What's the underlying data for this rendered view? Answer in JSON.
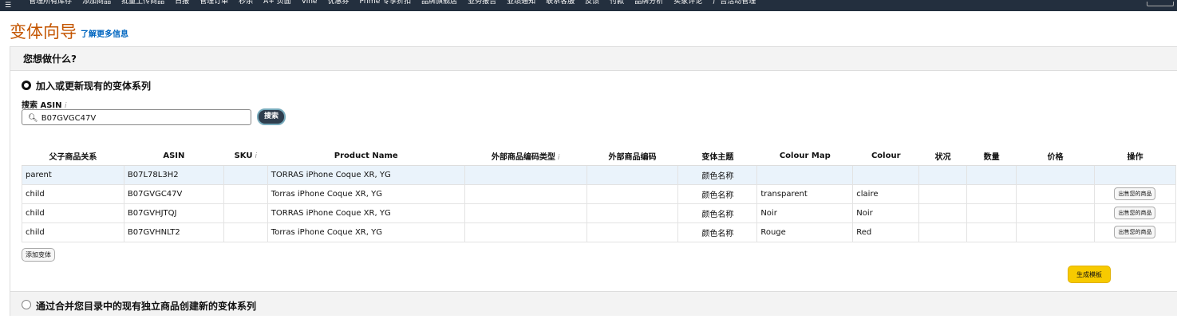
{
  "topnav": {
    "items": [
      "管理所有库存",
      "添加商品",
      "批量上传商品",
      "日报",
      "管理订单",
      "秒杀",
      "A+ 页面",
      "Vine",
      "优惠券",
      "Prime 专享折扣",
      "品牌旗舰店",
      "业务报告",
      "业绩通知",
      "联系客服",
      "反馈",
      "付款",
      "品牌分析",
      "买家评论",
      "广告活动管理"
    ]
  },
  "page": {
    "title": "变体向导",
    "learn_more": "了解更多信息"
  },
  "panel": {
    "header": "您想做什么?",
    "option1_label": "加入或更新现有的变体系列",
    "search_label": "搜索 ASIN",
    "search_value": "B07GVGC47V",
    "search_button": "搜索",
    "info_glyph": "i",
    "add_variation": "添加变体",
    "generate_template": "生成模板",
    "option2_label": "通过合并您目录中的现有独立商品创建新的变体系列"
  },
  "table": {
    "headers": [
      "父子商品关系",
      "ASIN",
      "SKU",
      "Product Name",
      "外部商品编码类型",
      "外部商品编码",
      "变体主题",
      "Colour Map",
      "Colour",
      "状况",
      "数量",
      "价格",
      "操作"
    ],
    "rows": [
      {
        "rel": "parent",
        "asin": "B07L78L3H2",
        "sku": "",
        "name": "TORRAS iPhone Coque XR, YG",
        "ext_type": "",
        "ext_code": "",
        "theme": "颜色名称",
        "colour_map": "",
        "colour": "",
        "condition": "",
        "qty": "",
        "price": "",
        "action": ""
      },
      {
        "rel": "child",
        "asin": "B07GVGC47V",
        "sku": "",
        "name": "Torras iPhone Coque XR, YG",
        "ext_type": "",
        "ext_code": "",
        "theme": "颜色名称",
        "colour_map": "transparent",
        "colour": "claire",
        "condition": "",
        "qty": "",
        "price": "",
        "action": "出售您的商品"
      },
      {
        "rel": "child",
        "asin": "B07GVHJTQJ",
        "sku": "",
        "name": "TORRAS iPhone Coque XR, YG",
        "ext_type": "",
        "ext_code": "",
        "theme": "颜色名称",
        "colour_map": "Noir",
        "colour": "Noir",
        "condition": "",
        "qty": "",
        "price": "",
        "action": "出售您的商品"
      },
      {
        "rel": "child",
        "asin": "B07GVHNLT2",
        "sku": "",
        "name": "Torras iPhone Coque XR, YG",
        "ext_type": "",
        "ext_code": "",
        "theme": "颜色名称",
        "colour_map": "Rouge",
        "colour": "Red",
        "condition": "",
        "qty": "",
        "price": "",
        "action": "出售您的商品"
      }
    ]
  },
  "colors": {
    "nav_bg": "#232f3e",
    "title": "#c45500",
    "link": "#0066c0",
    "generate_button": "#f7ca00"
  }
}
